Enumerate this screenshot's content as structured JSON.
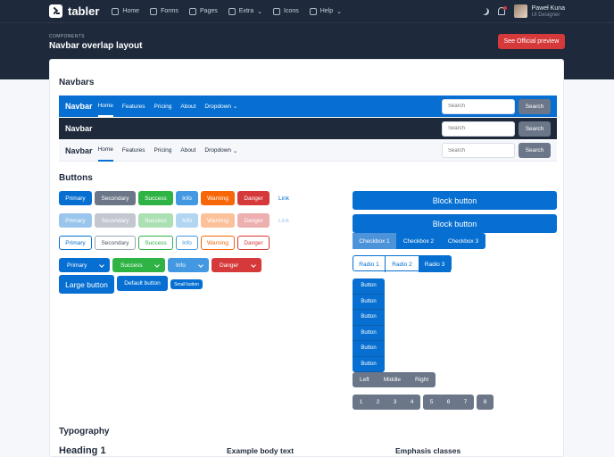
{
  "header": {
    "logo_text": "tabler",
    "nav": [
      {
        "label": "Home",
        "icon": "home-icon"
      },
      {
        "label": "Forms",
        "icon": "checkbox-icon"
      },
      {
        "label": "Pages",
        "icon": "file-icon"
      },
      {
        "label": "Extra",
        "icon": "star-icon"
      },
      {
        "label": "Icons",
        "icon": "ghost-icon"
      },
      {
        "label": "Help",
        "icon": "lifebuoy-icon"
      }
    ],
    "user": {
      "name": "Paweł Kuna",
      "role": "UI Designer"
    }
  },
  "page": {
    "pretitle": "COMPONENTS",
    "title": "Navbar overlap layout",
    "preview_button": "See Official preview"
  },
  "navbars": {
    "title": "Navbars",
    "brand": "Navbar",
    "links": [
      "Home",
      "Features",
      "Pricing",
      "About",
      "Dropdown"
    ],
    "search_placeholder": "Search",
    "search_button": "Search"
  },
  "buttons": {
    "title": "Buttons",
    "labels": [
      "Primary",
      "Secondary",
      "Success",
      "Info",
      "Warning",
      "Danger",
      "Link"
    ],
    "dropdowns": [
      "Primary",
      "Success",
      "Info",
      "Danger"
    ],
    "large": "Large button",
    "default": "Default button",
    "small": "Small button",
    "block": "Block button",
    "checkboxes": [
      "Checkbox 1",
      "Checkbox 2",
      "Checkbox 3"
    ],
    "radios": [
      "Radio 1",
      "Radio 2",
      "Radio 3"
    ],
    "vertical": "Button",
    "alignment": [
      "Left",
      "Middle",
      "Right"
    ],
    "pages": [
      "1",
      "2",
      "3",
      "4",
      "5",
      "6",
      "7",
      "8"
    ]
  },
  "typography": {
    "title": "Typography",
    "heading1": "Heading 1",
    "body_text": "Example body text",
    "emphasis": "Emphasis classes"
  },
  "colors": {
    "primary": "#066fd1",
    "secondary": "#6b7688",
    "success": "#2fb344",
    "info": "#4299e1",
    "warning": "#f76707",
    "danger": "#d63939",
    "dark": "#1e293b"
  }
}
